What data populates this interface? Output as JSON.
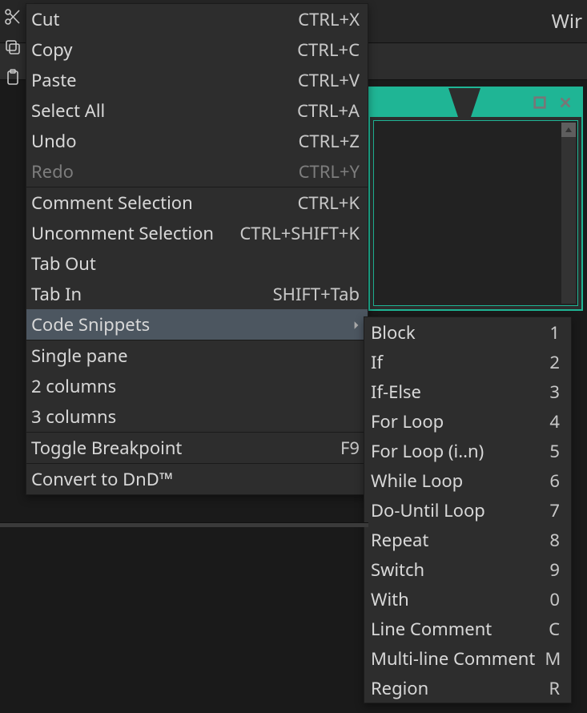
{
  "titlebar": {
    "title": "Wir"
  },
  "menu": {
    "groups": [
      [
        {
          "label": "Cut",
          "shortcut": "CTRL+X",
          "disabled": false,
          "submenu": false
        },
        {
          "label": "Copy",
          "shortcut": "CTRL+C",
          "disabled": false,
          "submenu": false
        },
        {
          "label": "Paste",
          "shortcut": "CTRL+V",
          "disabled": false,
          "submenu": false
        },
        {
          "label": "Select All",
          "shortcut": "CTRL+A",
          "disabled": false,
          "submenu": false
        },
        {
          "label": "Undo",
          "shortcut": "CTRL+Z",
          "disabled": false,
          "submenu": false
        },
        {
          "label": "Redo",
          "shortcut": "CTRL+Y",
          "disabled": true,
          "submenu": false
        }
      ],
      [
        {
          "label": "Comment Selection",
          "shortcut": "CTRL+K",
          "disabled": false,
          "submenu": false
        },
        {
          "label": "Uncomment Selection",
          "shortcut": "CTRL+SHIFT+K",
          "disabled": false,
          "submenu": false
        },
        {
          "label": "Tab Out",
          "shortcut": "",
          "disabled": false,
          "submenu": false
        },
        {
          "label": "Tab In",
          "shortcut": "SHIFT+Tab",
          "disabled": false,
          "submenu": false
        },
        {
          "label": "Code Snippets",
          "shortcut": "",
          "disabled": false,
          "submenu": true,
          "highlight": true
        }
      ],
      [
        {
          "label": "Single pane",
          "shortcut": "",
          "disabled": false,
          "submenu": false
        },
        {
          "label": "2 columns",
          "shortcut": "",
          "disabled": false,
          "submenu": false
        },
        {
          "label": "3 columns",
          "shortcut": "",
          "disabled": false,
          "submenu": false
        }
      ],
      [
        {
          "label": "Toggle Breakpoint",
          "shortcut": "F9",
          "disabled": false,
          "submenu": false
        }
      ],
      [
        {
          "label": "Convert to DnD™",
          "shortcut": "",
          "disabled": false,
          "submenu": false
        }
      ]
    ]
  },
  "snippets": [
    {
      "label": "Block",
      "shortcut": "1"
    },
    {
      "label": "If",
      "shortcut": "2"
    },
    {
      "label": "If-Else",
      "shortcut": "3"
    },
    {
      "label": "For Loop",
      "shortcut": "4"
    },
    {
      "label": "For Loop (i..n)",
      "shortcut": "5"
    },
    {
      "label": "While Loop",
      "shortcut": "6"
    },
    {
      "label": "Do-Until Loop",
      "shortcut": "7"
    },
    {
      "label": "Repeat",
      "shortcut": "8"
    },
    {
      "label": "Switch",
      "shortcut": "9"
    },
    {
      "label": "With",
      "shortcut": "0"
    },
    {
      "label": "Line Comment",
      "shortcut": "C"
    },
    {
      "label": "Multi-line Comment",
      "shortcut": "M"
    },
    {
      "label": "Region",
      "shortcut": "R"
    }
  ],
  "icons": {
    "cut": "scissors-icon",
    "copy": "copy-icon",
    "paste": "clipboard-icon"
  },
  "colors": {
    "accent_teal": "#1fb595",
    "menu_bg": "#2d2d2d",
    "highlight": "#4c5660"
  }
}
